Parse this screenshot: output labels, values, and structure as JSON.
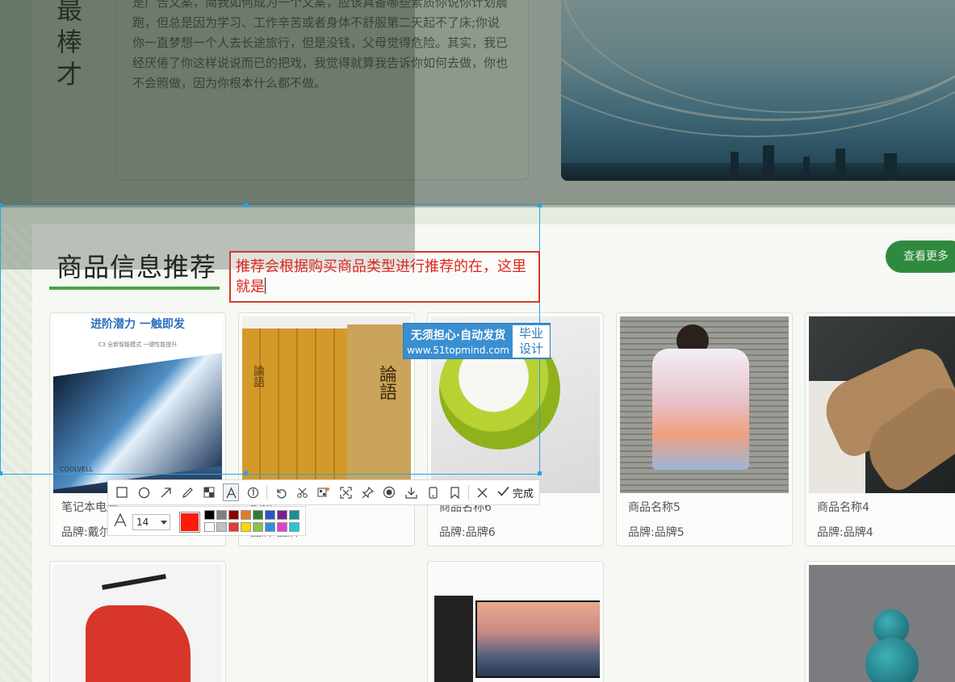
{
  "intro": {
    "vertical_title": [
      "最",
      "棒",
      "才"
    ],
    "paragraph": "是广告文案，简我如何成为一个文案，应该具备哪些素质你说你计划晨跑，但总是因为学习、工作辛苦或者身体不舒服第二天起不了床;你说你一直梦想一个人去长途旅行，但是没钱，父母觉得危险。其实，我已经厌倦了你这样说说而已的把戏，我觉得就算我告诉你如何去做，你也不会照做，因为你根本什么都不做。"
  },
  "section": {
    "title": "商品信息推荐",
    "more_label": "查看更多",
    "accent_color": "#4fa24a"
  },
  "products_row1": [
    {
      "name": "笔记本电脑",
      "brand": "品牌:戴尔",
      "img_caption": "进阶潜力 一触即发",
      "img_sub": "C3 全新智能模式 一键性能提升",
      "img_logo": "COOLVELL"
    },
    {
      "name": "论语",
      "brand": "品牌:品牌7",
      "book_spine": "論語",
      "book_cover": "論語"
    },
    {
      "name": "商品名称6",
      "brand": "品牌:品牌6"
    },
    {
      "name": "商品名称5",
      "brand": "品牌:品牌5"
    },
    {
      "name": "商品名称4",
      "brand": "品牌:品牌4"
    }
  ],
  "annotation": {
    "text": "推荐会根据购买商品类型进行推荐的在，这里就是",
    "color": "#e0241b"
  },
  "watermark": {
    "line1": "无须担心·自动发货",
    "line2": "www.51topmind.com",
    "right1": "毕业",
    "right2": "设计"
  },
  "toolbar": {
    "tools": [
      {
        "name": "rectangle-tool",
        "icon": "rectangle-icon"
      },
      {
        "name": "ellipse-tool",
        "icon": "ellipse-icon"
      },
      {
        "name": "arrow-tool",
        "icon": "arrow-icon"
      },
      {
        "name": "pen-tool",
        "icon": "pencil-icon"
      },
      {
        "name": "mosaic-tool",
        "icon": "mosaic-icon"
      },
      {
        "name": "text-tool",
        "icon": "text-icon",
        "active": true
      },
      {
        "name": "number-tool",
        "icon": "number-icon"
      },
      {
        "name": "undo-tool",
        "icon": "undo-icon"
      },
      {
        "name": "cut-tool",
        "icon": "scissors-icon"
      },
      {
        "name": "ocr-tool",
        "icon": "ocr-icon"
      },
      {
        "name": "long-capture-tool",
        "icon": "expand-icon"
      },
      {
        "name": "pin-tool",
        "icon": "pin-icon"
      },
      {
        "name": "record-tool",
        "icon": "record-icon"
      },
      {
        "name": "save-tool",
        "icon": "download-icon"
      },
      {
        "name": "phone-tool",
        "icon": "phone-icon"
      },
      {
        "name": "bookmark-tool",
        "icon": "bookmark-icon"
      },
      {
        "name": "cancel-tool",
        "icon": "close-icon"
      }
    ],
    "done_label": "完成"
  },
  "text_options": {
    "font_icon": "A",
    "font_size": "14",
    "current_color": "#ff1a0a",
    "palette": [
      "#000000",
      "#808080",
      "#8b0000",
      "#e07b2a",
      "#2e7d32",
      "#2a54c8",
      "#7b1f8c",
      "#1a8f9a",
      "#ffffff",
      "#c0c0c0",
      "#e53935",
      "#ffd600",
      "#8bc34a",
      "#2f8fe0",
      "#e040d0",
      "#26c6da"
    ]
  }
}
